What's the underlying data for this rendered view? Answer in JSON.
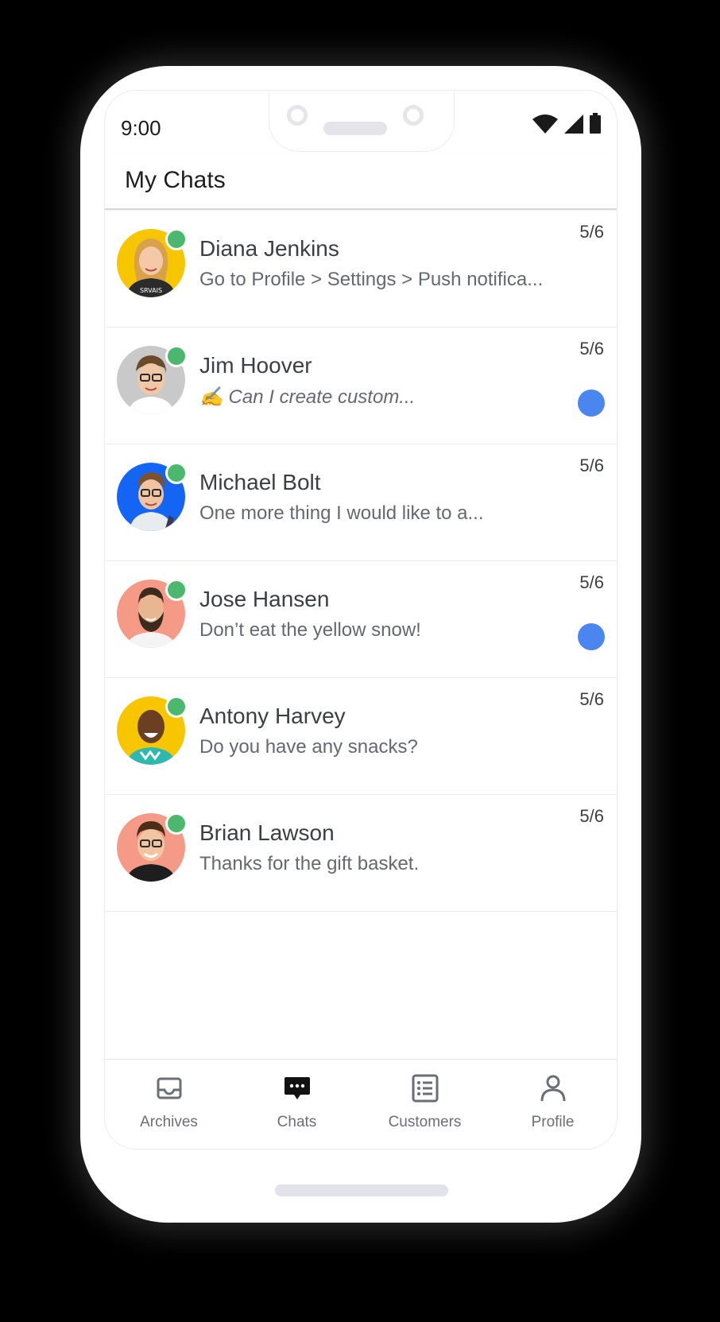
{
  "status_bar": {
    "time": "9:00",
    "icons": [
      "wifi-icon",
      "cell-signal-icon",
      "battery-icon"
    ]
  },
  "header": {
    "title": "My Chats"
  },
  "chats": [
    {
      "name": "Diana Jenkins",
      "preview": "Go to Profile > Settings > Push notifica...",
      "date": "5/6",
      "online": true,
      "unread": false,
      "typing": false,
      "avatar_bg": "#f7c600"
    },
    {
      "name": "Jim Hoover",
      "preview": "✍️ Can I create custom...",
      "date": "5/6",
      "online": true,
      "unread": true,
      "typing": true,
      "avatar_bg": "#c9c9c9"
    },
    {
      "name": "Michael Bolt",
      "preview": "One more thing I would like to a...",
      "date": "5/6",
      "online": true,
      "unread": false,
      "typing": false,
      "avatar_bg": "#1565f5"
    },
    {
      "name": "Jose Hansen",
      "preview": "Don’t eat the yellow snow!",
      "date": "5/6",
      "online": true,
      "unread": true,
      "typing": false,
      "avatar_bg": "#f59a86"
    },
    {
      "name": "Antony Harvey",
      "preview": "Do you have any snacks?",
      "date": "5/6",
      "online": true,
      "unread": false,
      "typing": false,
      "avatar_bg": "#f7c600"
    },
    {
      "name": "Brian Lawson",
      "preview": "Thanks for the gift basket.",
      "date": "5/6",
      "online": true,
      "unread": false,
      "typing": false,
      "avatar_bg": "#f59a86"
    }
  ],
  "bottom_nav": {
    "items": [
      {
        "label": "Archives",
        "icon": "inbox-icon",
        "active": false
      },
      {
        "label": "Chats",
        "icon": "chat-bubble-icon",
        "active": true
      },
      {
        "label": "Customers",
        "icon": "list-icon",
        "active": false
      },
      {
        "label": "Profile",
        "icon": "user-icon",
        "active": false
      }
    ]
  },
  "colors": {
    "online": "#4cb86e",
    "unread": "#4a85f0",
    "text_primary": "#3b3f44",
    "text_secondary": "#646870"
  }
}
